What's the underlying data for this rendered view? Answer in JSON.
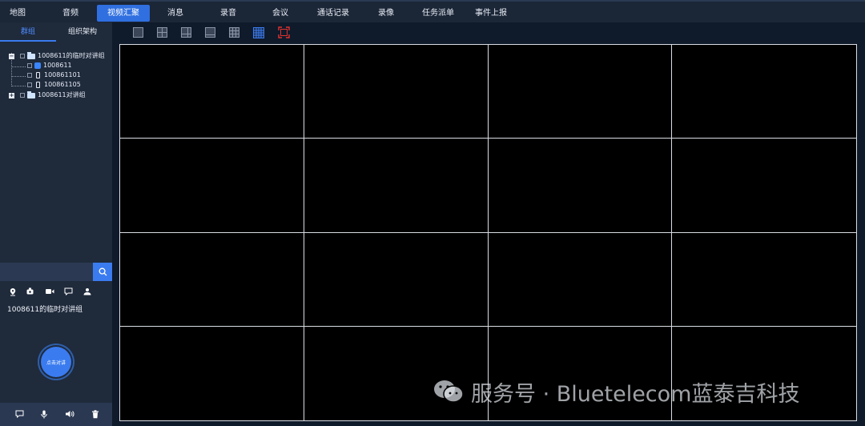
{
  "nav": {
    "tabs": [
      {
        "label": "地图"
      },
      {
        "label": "音频"
      },
      {
        "label": "视频汇聚",
        "active": true
      },
      {
        "label": "消息"
      },
      {
        "label": "录音"
      },
      {
        "label": "会议"
      },
      {
        "label": "通话记录"
      },
      {
        "label": "录像"
      },
      {
        "label": "任务派单"
      },
      {
        "label": "事件上报"
      }
    ]
  },
  "left_panel": {
    "tabs": [
      {
        "label": "群组",
        "active": true
      },
      {
        "label": "组织架构"
      }
    ],
    "tree": {
      "group1": {
        "label": "1008611的临时对讲组",
        "expander": "−"
      },
      "items": [
        {
          "label": "1008611"
        },
        {
          "label": "100861101"
        },
        {
          "label": "100861105"
        }
      ],
      "group2": {
        "label": "1008611对讲组",
        "expander": "+"
      }
    },
    "search": {
      "value": "",
      "placeholder": ""
    },
    "selected_group": "1008611的临时对讲组",
    "ptt_label": "点击对讲"
  },
  "watermark": {
    "text": "服务号 · Bluetelecom蓝泰吉科技"
  },
  "colors": {
    "accent": "#3a7bf0",
    "panel": "#1f2a3b",
    "background": "#0f1a2b",
    "grid_line": "#d9dde3",
    "fullscreen": "#e0322f"
  }
}
